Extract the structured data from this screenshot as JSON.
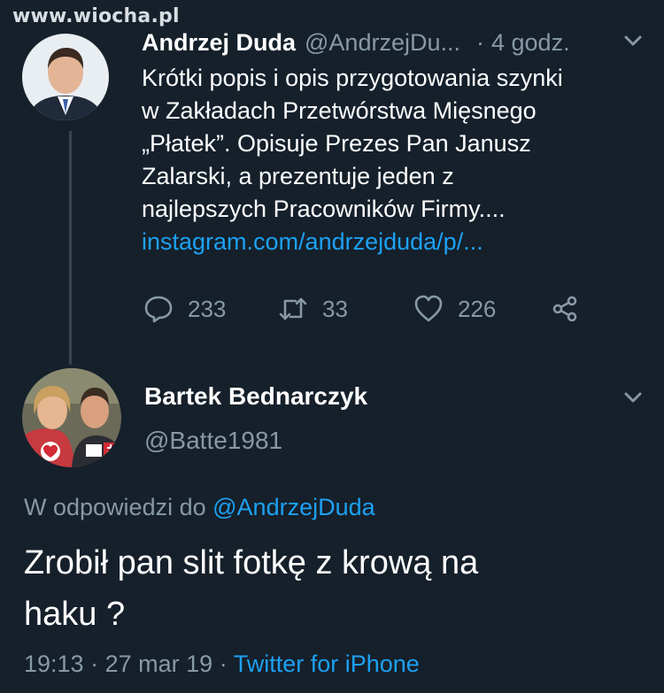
{
  "watermark": "www.wiocha.pl",
  "tweet": {
    "author_name": "Andrzej Duda",
    "author_handle": "@AndrzejDu...",
    "separator": "·",
    "time": "4 godz.",
    "body_lines": [
      "Krótki popis i opis przygotowania szynki",
      "w Zakładach Przetwórstwa Mięsnego",
      "„Płatek”. Opisuje Prezes Pan Janusz",
      "Zalarski, a prezentuje jeden z",
      "najlepszych Pracowników Firmy...."
    ],
    "link": "instagram.com/andrzejduda/p/...",
    "actions": {
      "replies": "233",
      "retweets": "33",
      "likes": "226"
    }
  },
  "reply": {
    "author_name": "Bartek Bednarczyk",
    "author_handle": "@Batte1981",
    "reply_prefix": "W odpowiedzi do",
    "reply_mention": "@AndrzejDuda",
    "text_lines": [
      "Zrobił pan slit fotkę z krową na",
      "haku ?"
    ],
    "time": "19:13",
    "separator": "·",
    "date": "27 mar 19",
    "separator2": "·",
    "source": "Twitter for iPhone"
  },
  "colors": {
    "background": "#15202b",
    "text": "#ffffff",
    "secondary": "#8899a6",
    "link": "#1da1f2",
    "thread_line": "#38444d"
  },
  "icons": [
    "reply-icon",
    "retweet-icon",
    "like-icon",
    "share-icon",
    "chevron-down-icon"
  ]
}
